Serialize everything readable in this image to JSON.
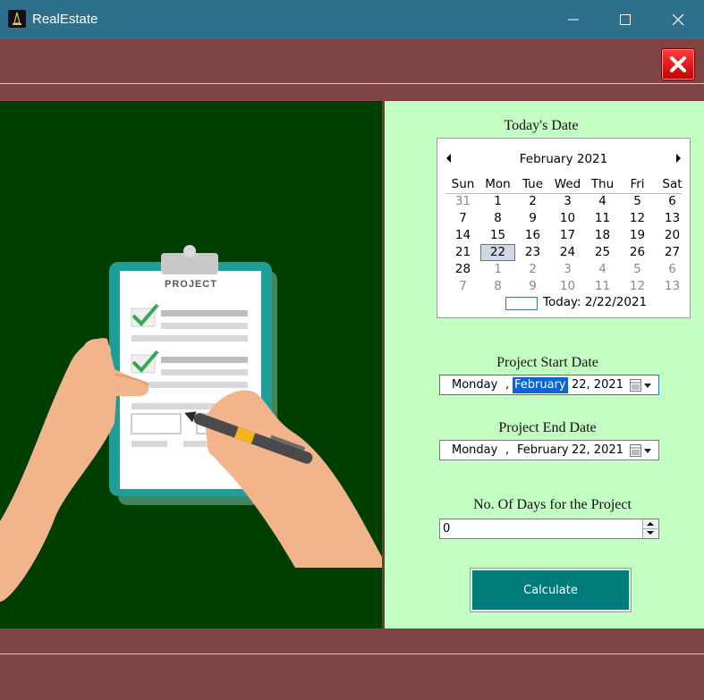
{
  "window": {
    "title": "RealEstate"
  },
  "illustration": {
    "clipboard_label": "PROJECT"
  },
  "calendar": {
    "heading": "Today's Date",
    "month_label": "February 2021",
    "weekdays": [
      "Sun",
      "Mon",
      "Tue",
      "Wed",
      "Thu",
      "Fri",
      "Sat"
    ],
    "weeks": [
      [
        "31",
        "1",
        "2",
        "3",
        "4",
        "5",
        "6"
      ],
      [
        "7",
        "8",
        "9",
        "10",
        "11",
        "12",
        "13"
      ],
      [
        "14",
        "15",
        "16",
        "17",
        "18",
        "19",
        "20"
      ],
      [
        "21",
        "22",
        "23",
        "24",
        "25",
        "26",
        "27"
      ],
      [
        "28",
        "1",
        "2",
        "3",
        "4",
        "5",
        "6"
      ],
      [
        "7",
        "8",
        "9",
        "10",
        "11",
        "12",
        "13"
      ]
    ],
    "selected_day": "22",
    "today_text": "Today: 2/22/2021"
  },
  "start_date": {
    "label": "Project Start Date",
    "weekday": "Monday",
    "sep": ",",
    "month": "February",
    "day_year": "22, 2021"
  },
  "end_date": {
    "label": "Project End Date",
    "weekday": "Monday",
    "sep": ",",
    "month": "February",
    "day_year": "22, 2021"
  },
  "days": {
    "label": "No. Of Days for the Project",
    "value": "0"
  },
  "calculate_label": "Calculate"
}
